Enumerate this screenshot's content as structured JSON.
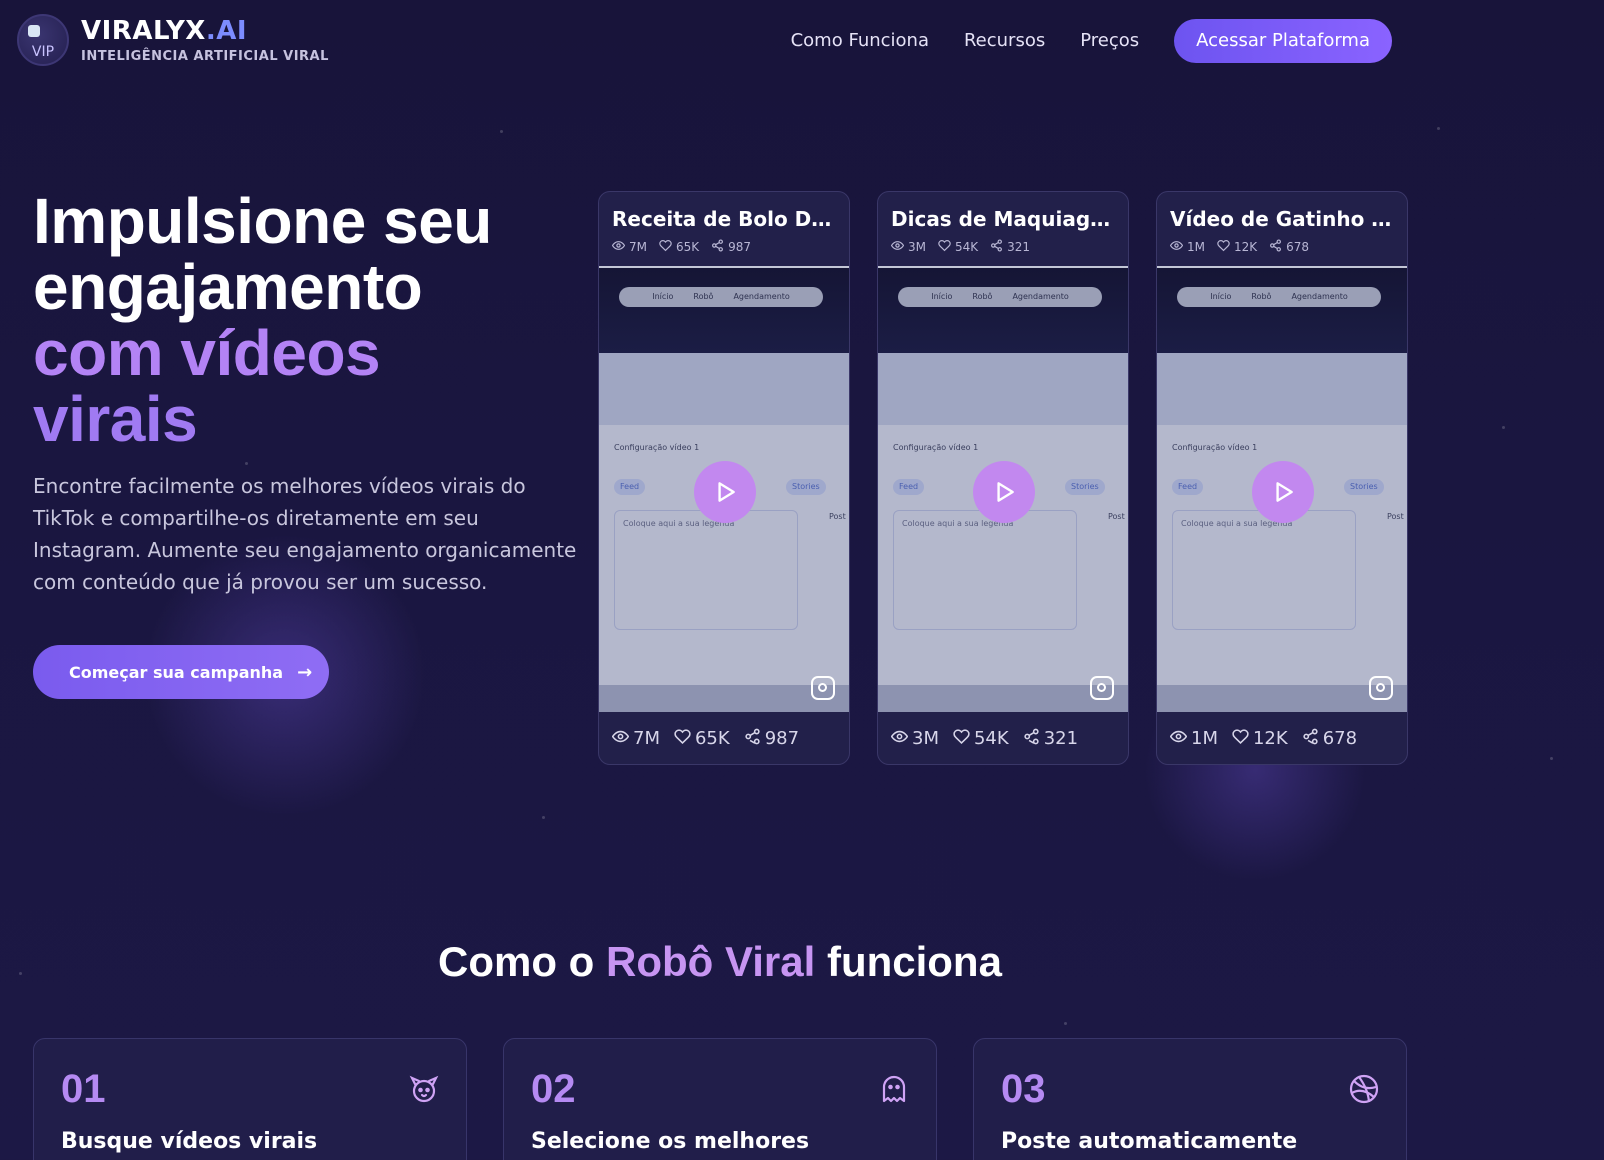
{
  "header": {
    "logo_text": "VIP",
    "brand_main": "VIRALYX",
    "brand_ai": ".AI",
    "brand_sub": "INTELIGÊNCIA ARTIFICIAL VIRAL",
    "nav": [
      "Como Funciona",
      "Recursos",
      "Preços"
    ],
    "cta": "Acessar Plataforma"
  },
  "hero": {
    "title_line1": "Impulsione seu",
    "title_line2": "engajamento",
    "title_line3": "com vídeos",
    "title_line4": "virais",
    "description": "Encontre facilmente os melhores vídeos virais do TikTok e compartilhe-os diretamente em seu Instagram. Aumente seu engajamento organicamente com conteúdo que já provou ser um sucesso.",
    "cta": "Começar sua campanha"
  },
  "cards": [
    {
      "title": "Receita de Bolo Deli...",
      "views": "7M",
      "likes": "65K",
      "shares": "987",
      "media_nav": [
        "Início",
        "Robô",
        "Agendamento"
      ],
      "panel_label": "Configuração vídeo 1",
      "pill_feed": "Feed",
      "pill_stories": "Stories",
      "caption_placeholder": "Coloque aqui a sua legenda",
      "post_label": "Post"
    },
    {
      "title": "Dicas de Maquiage...",
      "views": "3M",
      "likes": "54K",
      "shares": "321",
      "media_nav": [
        "Início",
        "Robô",
        "Agendamento"
      ],
      "panel_label": "Configuração vídeo 1",
      "pill_feed": "Feed",
      "pill_stories": "Stories",
      "caption_placeholder": "Coloque aqui a sua legenda",
      "post_label": "Post"
    },
    {
      "title": "Vídeo de Gatinho Fofo",
      "views": "1M",
      "likes": "12K",
      "shares": "678",
      "media_nav": [
        "Início",
        "Robô",
        "Agendamento"
      ],
      "panel_label": "Configuração vídeo 1",
      "pill_feed": "Feed",
      "pill_stories": "Stories",
      "caption_placeholder": "Coloque aqui a sua legenda",
      "post_label": "Post"
    }
  ],
  "how_it_works": {
    "title_pre": "Como o",
    "title_accent": "Robô Viral",
    "title_post": "funciona",
    "steps": [
      {
        "number": "01",
        "title": "Busque vídeos virais",
        "icon": "dog-icon"
      },
      {
        "number": "02",
        "title": "Selecione os melhores",
        "icon": "ghost-icon"
      },
      {
        "number": "03",
        "title": "Poste automaticamente",
        "icon": "dribbble-icon"
      }
    ]
  },
  "colors": {
    "background": "#1a1640",
    "accent": "#8a63ff",
    "title_gradient": "#b383f5",
    "play_button": "#c288ef"
  }
}
